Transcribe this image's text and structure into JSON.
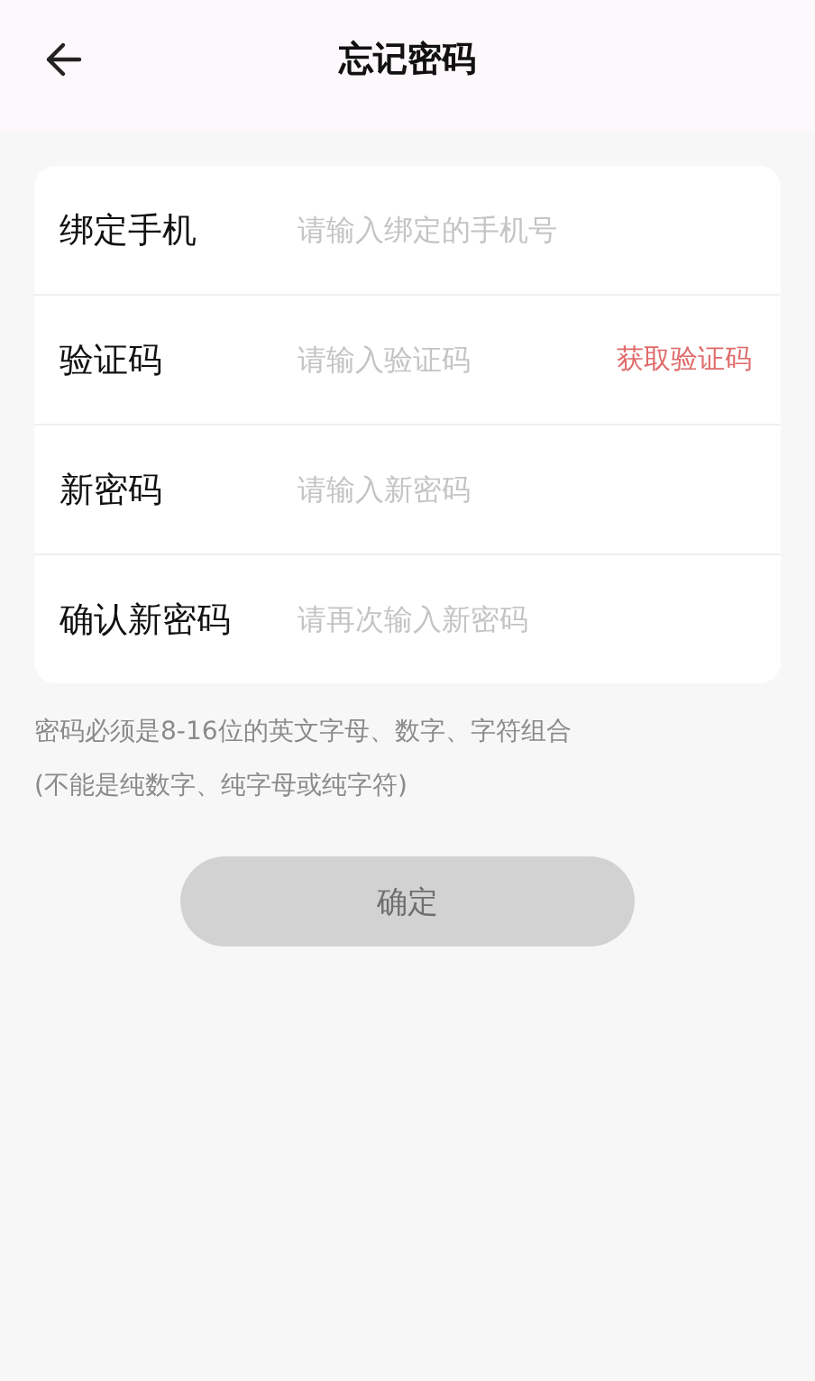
{
  "header": {
    "title": "忘记密码"
  },
  "form": {
    "rows": [
      {
        "label": "绑定手机",
        "placeholder": "请输入绑定的手机号"
      },
      {
        "label": "验证码",
        "placeholder": "请输入验证码",
        "action": "获取验证码"
      },
      {
        "label": "新密码",
        "placeholder": "请输入新密码"
      },
      {
        "label": "确认新密码",
        "placeholder": "请再次输入新密码"
      }
    ]
  },
  "hint": [
    "密码必须是8-16位的英文字母、数字、字符组合",
    "(不能是纯数字、纯字母或纯字符)"
  ],
  "confirm_button": {
    "label": "确定",
    "disabled": true
  }
}
